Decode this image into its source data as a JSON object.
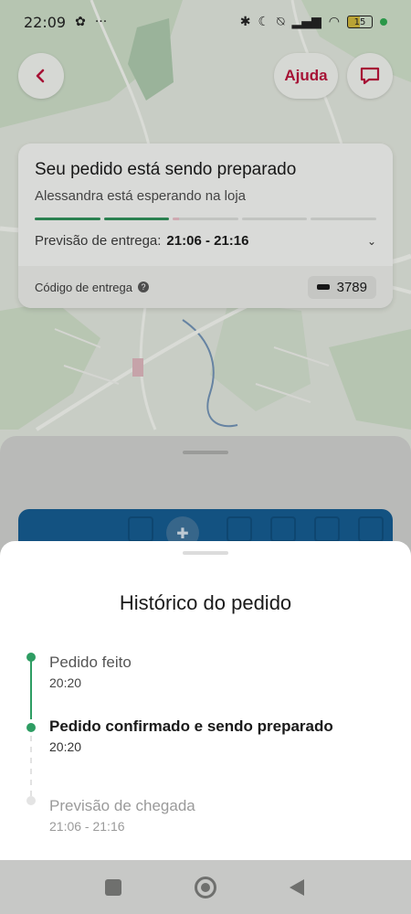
{
  "status_bar": {
    "time": "22:09",
    "battery": "15"
  },
  "header": {
    "back_icon": "chevron-left-icon",
    "help_label": "Ajuda",
    "chat_icon": "chat-bubble-icon"
  },
  "order_card": {
    "title": "Seu pedido está sendo preparado",
    "subtitle": "Alessandra está esperando na loja",
    "progress_segments": [
      1,
      1,
      0.1,
      0,
      0
    ],
    "eta_label": "Previsão de entrega:",
    "eta_value": "21:06 - 21:16",
    "code_label": "Código de entrega",
    "code_value": "3789"
  },
  "history": {
    "title": "Histórico do pedido",
    "items": [
      {
        "label": "Pedido feito",
        "time": "20:20",
        "state": "done"
      },
      {
        "label": "Pedido confirmado e sendo preparado",
        "time": "20:20",
        "state": "current"
      },
      {
        "label": "Previsão de chegada",
        "time": "21:06 - 21:16",
        "state": "pending"
      }
    ]
  },
  "colors": {
    "brand_red": "#b5143a",
    "progress_green": "#2e8b57",
    "timeline_green": "#2e9d63"
  }
}
